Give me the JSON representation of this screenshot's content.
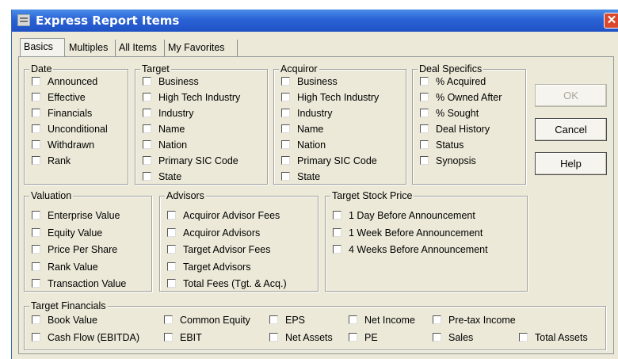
{
  "window": {
    "title": "Express Report Items",
    "close_glyph": "✕"
  },
  "tabs": [
    "Basics",
    "Multiples",
    "All Items",
    "My Favorites"
  ],
  "active_tab": "Basics",
  "buttons": {
    "ok": "OK",
    "cancel": "Cancel",
    "help": "Help"
  },
  "groups": {
    "date": {
      "label": "Date",
      "items": [
        "Announced",
        "Effective",
        "Financials",
        "Unconditional",
        "Withdrawn",
        "Rank"
      ]
    },
    "target": {
      "label": "Target",
      "items": [
        "Business",
        "High Tech Industry",
        "Industry",
        "Name",
        "Nation",
        "Primary SIC Code",
        "State"
      ]
    },
    "acquiror": {
      "label": "Acquiror",
      "items": [
        "Business",
        "High Tech Industry",
        "Industry",
        "Name",
        "Nation",
        "Primary SIC Code",
        "State"
      ]
    },
    "deal_specifics": {
      "label": "Deal Specifics",
      "items": [
        "% Acquired",
        "% Owned After",
        "% Sought",
        "Deal History",
        "Status",
        "Synopsis"
      ]
    },
    "valuation": {
      "label": "Valuation",
      "items": [
        "Enterprise Value",
        "Equity Value",
        "Price Per Share",
        "Rank Value",
        "Transaction Value"
      ]
    },
    "advisors": {
      "label": "Advisors",
      "items": [
        "Acquiror Advisor Fees",
        "Acquiror Advisors",
        "Target Advisor Fees",
        "Target Advisors",
        "Total Fees (Tgt. & Acq.)"
      ]
    },
    "target_stock_price": {
      "label": "Target Stock Price",
      "items": [
        "1 Day Before Announcement",
        "1 Week Before Announcement",
        "4 Weeks Before Announcement"
      ]
    },
    "target_financials": {
      "label": "Target Financials",
      "items": [
        "Book Value",
        "Cash Flow (EBITDA)",
        "Common Equity",
        "EBIT",
        "EPS",
        "Net Assets",
        "Net Income",
        "PE",
        "Pre-tax Income",
        "Sales",
        "Total Assets"
      ]
    }
  }
}
